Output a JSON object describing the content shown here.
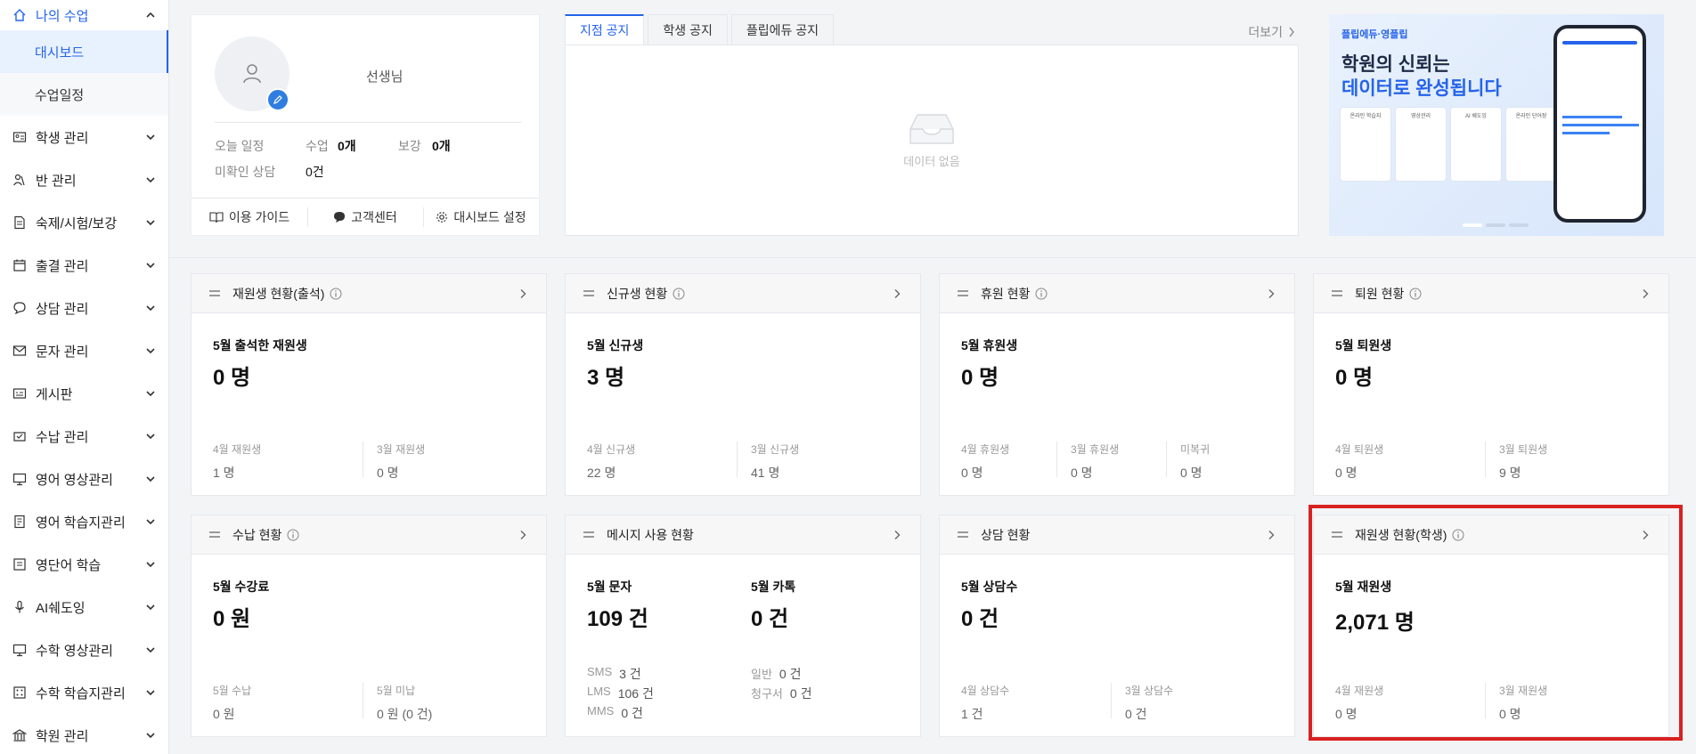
{
  "sidebar": {
    "top": {
      "label": "나의 수업"
    },
    "sub_items": [
      {
        "label": "대시보드",
        "active": true
      },
      {
        "label": "수업일정",
        "active": false
      }
    ],
    "items": [
      {
        "label": "학생 관리",
        "icon": "id-card-icon"
      },
      {
        "label": "반 관리",
        "icon": "users-icon"
      },
      {
        "label": "숙제/시험/보강",
        "icon": "document-icon"
      },
      {
        "label": "출결 관리",
        "icon": "calendar-icon"
      },
      {
        "label": "상담 관리",
        "icon": "chat-icon"
      },
      {
        "label": "문자 관리",
        "icon": "mail-icon"
      },
      {
        "label": "게시판",
        "icon": "board-icon"
      },
      {
        "label": "수납 관리",
        "icon": "wallet-icon"
      },
      {
        "label": "영어 영상관리",
        "icon": "monitor-icon"
      },
      {
        "label": "영어 학습지관리",
        "icon": "book-icon"
      },
      {
        "label": "영단어 학습",
        "icon": "word-icon"
      },
      {
        "label": "AI쉐도잉",
        "icon": "mic-icon"
      },
      {
        "label": "수학 영상관리",
        "icon": "monitor-icon"
      },
      {
        "label": "수학 학습지관리",
        "icon": "grid-icon"
      },
      {
        "label": "학원 관리",
        "icon": "building-icon"
      }
    ]
  },
  "profile": {
    "teacher_label": "선생님",
    "today_label": "오늘 일정",
    "class_label": "수업",
    "class_value": "0개",
    "makeup_label": "보강",
    "makeup_value": "0개",
    "unread_label": "미확인 상담",
    "unread_value": "0건",
    "buttons": {
      "guide": "이용 가이드",
      "support": "고객센터",
      "settings": "대시보드 설정"
    }
  },
  "notice": {
    "tabs": [
      "지점 공지",
      "학생 공지",
      "플립에듀 공지"
    ],
    "more_label": "더보기",
    "empty_text": "데이터 없음"
  },
  "banner": {
    "brand": "플립에듀·영플립",
    "title_line1": "학원의 신뢰는",
    "title_line2": "데이터로 완성됩니다",
    "cards": [
      "온라인 학습지",
      "영상관리",
      "AI 쉐도잉",
      "온라인 단어장"
    ]
  },
  "cards": [
    {
      "title": "재원생 현황(출석)",
      "info": true,
      "main_label": "5월 출석한 재원생",
      "main_value": "0 명",
      "subs": [
        {
          "label": "4월 재원생",
          "value": "1 명"
        },
        {
          "label": "3월 재원생",
          "value": "0 명"
        }
      ]
    },
    {
      "title": "신규생 현황",
      "info": true,
      "main_label": "5월 신규생",
      "main_value": "3 명",
      "subs": [
        {
          "label": "4월 신규생",
          "value": "22 명"
        },
        {
          "label": "3월 신규생",
          "value": "41 명"
        }
      ]
    },
    {
      "title": "휴원 현황",
      "info": true,
      "main_label": "5월 휴원생",
      "main_value": "0 명",
      "subs": [
        {
          "label": "4월 휴원생",
          "value": "0 명"
        },
        {
          "label": "3월 휴원생",
          "value": "0 명"
        },
        {
          "label": "미복귀",
          "value": "0 명"
        }
      ]
    },
    {
      "title": "퇴원 현황",
      "info": true,
      "main_label": "5월 퇴원생",
      "main_value": "0 명",
      "subs": [
        {
          "label": "4월 퇴원생",
          "value": "0 명"
        },
        {
          "label": "3월 퇴원생",
          "value": "9 명"
        }
      ]
    },
    {
      "title": "수납 현황",
      "info": true,
      "main_label": "5월 수강료",
      "main_value": "0 원",
      "subs": [
        {
          "label": "5월 수납",
          "value": "0 원"
        },
        {
          "label": "5월 미납",
          "value": "0 원 (0 건)"
        }
      ]
    },
    {
      "title": "메시지 사용 현황",
      "info": false,
      "main_label": "5월 문자",
      "main_value": "109 건",
      "second_label": "5월 카톡",
      "second_value": "0 건",
      "rows_left": [
        {
          "label": "SMS",
          "value": "3 건"
        },
        {
          "label": "LMS",
          "value": "106 건"
        },
        {
          "label": "MMS",
          "value": "0 건"
        }
      ],
      "rows_right": [
        {
          "label": "일반",
          "value": "0 건"
        },
        {
          "label": "청구서",
          "value": "0 건"
        }
      ]
    },
    {
      "title": "상담 현황",
      "info": false,
      "main_label": "5월 상담수",
      "main_value": "0 건",
      "subs": [
        {
          "label": "4월 상담수",
          "value": "1 건"
        },
        {
          "label": "3월 상담수",
          "value": "0 건"
        }
      ]
    },
    {
      "title": "재원생 현황(학생)",
      "info": true,
      "main_label": "5월 재원생",
      "main_value": "2,071 명",
      "subs": [
        {
          "label": "4월 재원생",
          "value": "0 명"
        },
        {
          "label": "3월 재원생",
          "value": "0 명"
        }
      ]
    }
  ],
  "colors": {
    "accent": "#2563eb",
    "highlight": "#d92121"
  }
}
